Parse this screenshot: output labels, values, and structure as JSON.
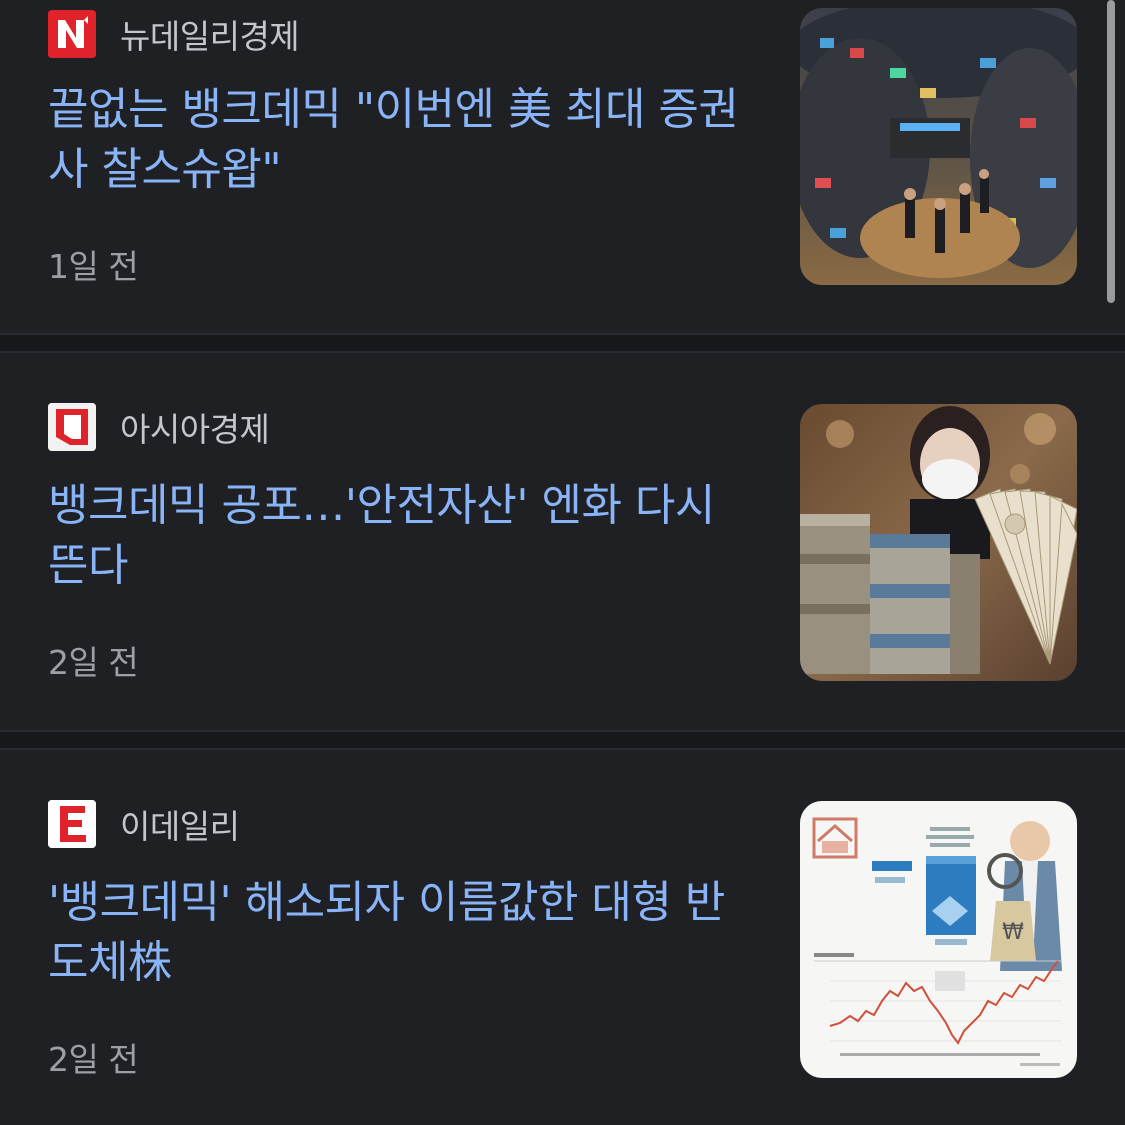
{
  "articles": [
    {
      "source": "뉴데일리경제",
      "logo_icon": "newdaily-n-logo",
      "logo_color": "#e0232a",
      "headline": "끝없는 뱅크데믹 \"이번엔 美 최대 증권사 찰스슈왑\"",
      "time": "1일 전",
      "thumbnail": "stock-exchange-floor-photo"
    },
    {
      "source": "아시아경제",
      "logo_icon": "asiae-logo",
      "logo_color": "#e0232a",
      "headline": "뱅크데믹 공포…'안전자산' 엔화 다시 뜬다",
      "time": "2일 전",
      "thumbnail": "yen-banknotes-photo"
    },
    {
      "source": "이데일리",
      "logo_icon": "edaily-e-logo",
      "logo_color": "#e0232a",
      "headline": "'뱅크데믹' 해소되자 이름값한 대형 반도체株",
      "time": "2일 전",
      "thumbnail": "semiconductor-infographic"
    }
  ],
  "colors": {
    "background": "#1f2024",
    "headline": "#8ab4f8",
    "source": "#c4c6cb",
    "time": "#9aa0a6"
  }
}
